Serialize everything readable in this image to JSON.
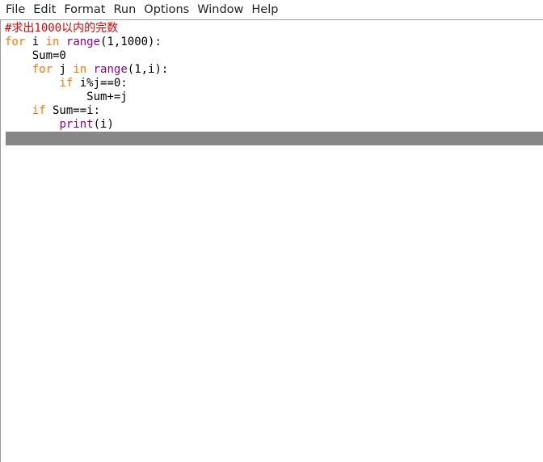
{
  "menubar": {
    "items": [
      "File",
      "Edit",
      "Format",
      "Run",
      "Options",
      "Window",
      "Help"
    ]
  },
  "colors": {
    "keyword": "#ff7700",
    "builtin": "#900090",
    "comment": "#dd0000",
    "default": "#000000",
    "current_line": "#868686"
  },
  "editor": {
    "lines": [
      [
        {
          "t": "#求出1000以内的完数",
          "c": "comment"
        }
      ],
      [
        {
          "t": "for",
          "c": "keyword"
        },
        {
          "t": " i ",
          "c": "default"
        },
        {
          "t": "in",
          "c": "keyword"
        },
        {
          "t": " ",
          "c": "default"
        },
        {
          "t": "range",
          "c": "builtin"
        },
        {
          "t": "(1,1000):",
          "c": "default"
        }
      ],
      [
        {
          "t": "    Sum=0",
          "c": "default"
        }
      ],
      [
        {
          "t": "    ",
          "c": "default"
        },
        {
          "t": "for",
          "c": "keyword"
        },
        {
          "t": " j ",
          "c": "default"
        },
        {
          "t": "in",
          "c": "keyword"
        },
        {
          "t": " ",
          "c": "default"
        },
        {
          "t": "range",
          "c": "builtin"
        },
        {
          "t": "(1,i):",
          "c": "default"
        }
      ],
      [
        {
          "t": "        ",
          "c": "default"
        },
        {
          "t": "if",
          "c": "keyword"
        },
        {
          "t": " i%j==0:",
          "c": "default"
        }
      ],
      [
        {
          "t": "            Sum+=j",
          "c": "default"
        }
      ],
      [
        {
          "t": "    ",
          "c": "default"
        },
        {
          "t": "if",
          "c": "keyword"
        },
        {
          "t": " Sum==i:",
          "c": "default"
        }
      ],
      [
        {
          "t": "        ",
          "c": "default"
        },
        {
          "t": "print",
          "c": "builtin"
        },
        {
          "t": "(i)",
          "c": "default"
        }
      ],
      []
    ],
    "current_line_index": 8
  }
}
